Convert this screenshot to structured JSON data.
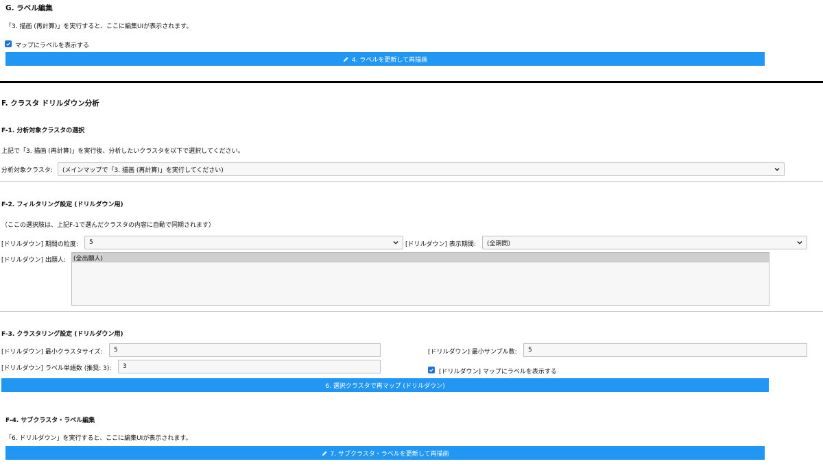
{
  "g": {
    "title": "G. ラベル編集",
    "note": "「3. 描画 (再計算)」を実行すると、ここに編集UIが表示されます。",
    "show_labels": {
      "label": "マップにラベルを表示する",
      "checked": true
    },
    "update_button": "4. ラベルを更新して再描画"
  },
  "f": {
    "title": "F. クラスタ ドリルダウン分析",
    "f1": {
      "title": "F-1. 分析対象クラスタの選択",
      "note": "上記で「3. 描画 (再計算)」を実行後、分析したいクラスタを以下で選択してください。",
      "cluster_label": "分析対象クラスタ:",
      "cluster_value": "(メインマップで「3. 描画 (再計算)」を実行してください)"
    },
    "f2": {
      "title": "F-2. フィルタリング設定 (ドリルダウン用)",
      "note": "（ここの選択肢は、上記F-1で選んだクラスタの内容に自動で同期されます）",
      "granularity_label": "[ドリルダウン] 期間の粒度:",
      "granularity_value": "5",
      "period_label": "[ドリルダウン] 表示期間:",
      "period_value": "(全期間)",
      "applicant_label": "[ドリルダウン] 出願人:",
      "applicant_options": [
        "(全出願人)"
      ]
    },
    "f3": {
      "title": "F-3. クラスタリング設定 (ドリルダウン用)",
      "min_cluster_label": "[ドリルダウン] 最小クラスタサイズ:",
      "min_cluster_value": "5",
      "min_samples_label": "[ドリルダウン] 最小サンプル数:",
      "min_samples_value": "5",
      "label_words_label": "[ドリルダウン] ラベル単語数 (推奨: 3):",
      "label_words_value": "3",
      "show_labels": {
        "label": "[ドリルダウン] マップにラベルを表示する",
        "checked": true
      },
      "remap_button": "6. 選択クラスタで再マップ (ドリルダウン)"
    },
    "f4": {
      "title": "F-4. サブクラスタ・ラベル編集",
      "note": "「6. ドリルダウン」を実行すると、ここに編集UIが表示されます。",
      "update_button": "7. サブクラスタ・ラベルを更新して再描画"
    }
  },
  "colors": {
    "accent": "#2196f3",
    "checkbox": "#1e73d6",
    "divider": "#c8c8c8"
  },
  "icons": {
    "pencil": "pencil-icon",
    "chevron": "chevron-down-icon",
    "check": "check-icon"
  }
}
